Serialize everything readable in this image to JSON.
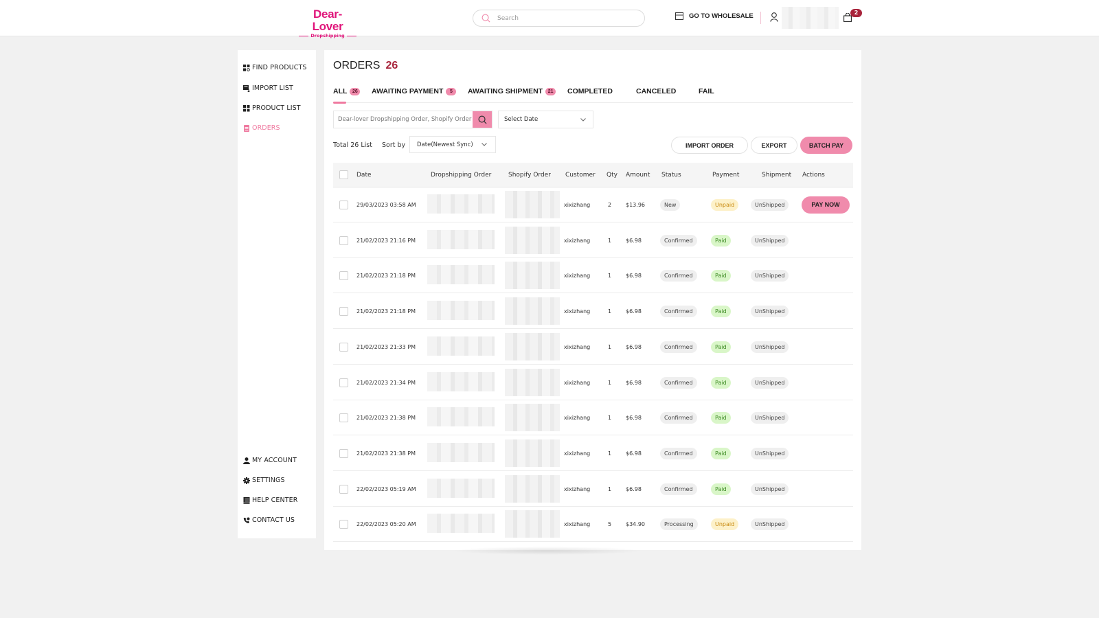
{
  "header": {
    "logo_main": "Dear-Lover",
    "logo_sub": "Dropshipping",
    "search_placeholder": "Search",
    "wholesale_label": "GO TO WHOLESALE",
    "cart_count": "2",
    "brand_color": "#e0147a",
    "accent_color": "#f08bac"
  },
  "sidebar": {
    "top_items": [
      {
        "label": "FIND PRODUCTS",
        "icon": "grid-icon"
      },
      {
        "label": "IMPORT LIST",
        "icon": "import-icon"
      },
      {
        "label": "PRODUCT LIST",
        "icon": "grid-icon"
      },
      {
        "label": "ORDERS",
        "icon": "document-icon",
        "active": true
      }
    ],
    "bottom_items": [
      {
        "label": "MY ACCOUNT",
        "icon": "user-icon"
      },
      {
        "label": "SETTINGS",
        "icon": "gear-icon"
      },
      {
        "label": "HELP CENTER",
        "icon": "book-icon"
      },
      {
        "label": "CONTACT US",
        "icon": "phone-icon"
      }
    ]
  },
  "main": {
    "title": "ORDERS",
    "title_count": "26",
    "tabs": [
      {
        "label": "ALL",
        "badge": "26",
        "active": true
      },
      {
        "label": "AWAITING PAYMENT",
        "badge": "5"
      },
      {
        "label": "AWAITING SHIPMENT",
        "badge": "21"
      },
      {
        "label": "COMPLETED"
      },
      {
        "label": "CANCELED"
      },
      {
        "label": "FAIL"
      }
    ],
    "order_search_placeholder": "Dear-lover Dropshipping Order, Shopify Order",
    "date_select": "Select Date",
    "total_label": "Total 26 List",
    "sort_label": "Sort by",
    "sort_value": "Date(Newest Sync)",
    "buttons": {
      "import_order": "IMPORT ORDER",
      "export": "EXPORT",
      "batch_pay": "BATCH PAY",
      "pay_now": "PAY NOW"
    }
  },
  "table": {
    "columns": [
      "Date",
      "Dropshipping Order",
      "Shopify Order",
      "Customer",
      "Qty",
      "Amount",
      "Status",
      "Payment",
      "Shipment",
      "Actions"
    ],
    "rows": [
      {
        "date": "29/03/2023 03:58 AM",
        "customer": "xixizhang",
        "qty": "2",
        "amount": "$13.96",
        "status": "New",
        "payment": "Unpaid",
        "shipment": "UnShipped",
        "action": "PAY NOW"
      },
      {
        "date": "21/02/2023 21:16 PM",
        "customer": "xixizhang",
        "qty": "1",
        "amount": "$6.98",
        "status": "Confirmed",
        "payment": "Paid",
        "shipment": "UnShipped"
      },
      {
        "date": "21/02/2023 21:18 PM",
        "customer": "xixizhang",
        "qty": "1",
        "amount": "$6.98",
        "status": "Confirmed",
        "payment": "Paid",
        "shipment": "UnShipped"
      },
      {
        "date": "21/02/2023 21:18 PM",
        "customer": "xixizhang",
        "qty": "1",
        "amount": "$6.98",
        "status": "Confirmed",
        "payment": "Paid",
        "shipment": "UnShipped"
      },
      {
        "date": "21/02/2023 21:33 PM",
        "customer": "xixizhang",
        "qty": "1",
        "amount": "$6.98",
        "status": "Confirmed",
        "payment": "Paid",
        "shipment": "UnShipped"
      },
      {
        "date": "21/02/2023 21:34 PM",
        "customer": "xixizhang",
        "qty": "1",
        "amount": "$6.98",
        "status": "Confirmed",
        "payment": "Paid",
        "shipment": "UnShipped"
      },
      {
        "date": "21/02/2023 21:38 PM",
        "customer": "xixizhang",
        "qty": "1",
        "amount": "$6.98",
        "status": "Confirmed",
        "payment": "Paid",
        "shipment": "UnShipped"
      },
      {
        "date": "21/02/2023 21:38 PM",
        "customer": "xixizhang",
        "qty": "1",
        "amount": "$6.98",
        "status": "Confirmed",
        "payment": "Paid",
        "shipment": "UnShipped"
      },
      {
        "date": "22/02/2023 05:19 AM",
        "customer": "xixizhang",
        "qty": "1",
        "amount": "$6.98",
        "status": "Confirmed",
        "payment": "Paid",
        "shipment": "UnShipped"
      },
      {
        "date": "22/02/2023 05:20 AM",
        "customer": "xixizhang",
        "qty": "5",
        "amount": "$34.90",
        "status": "Processing",
        "payment": "Unpaid",
        "shipment": "UnShipped"
      }
    ]
  }
}
